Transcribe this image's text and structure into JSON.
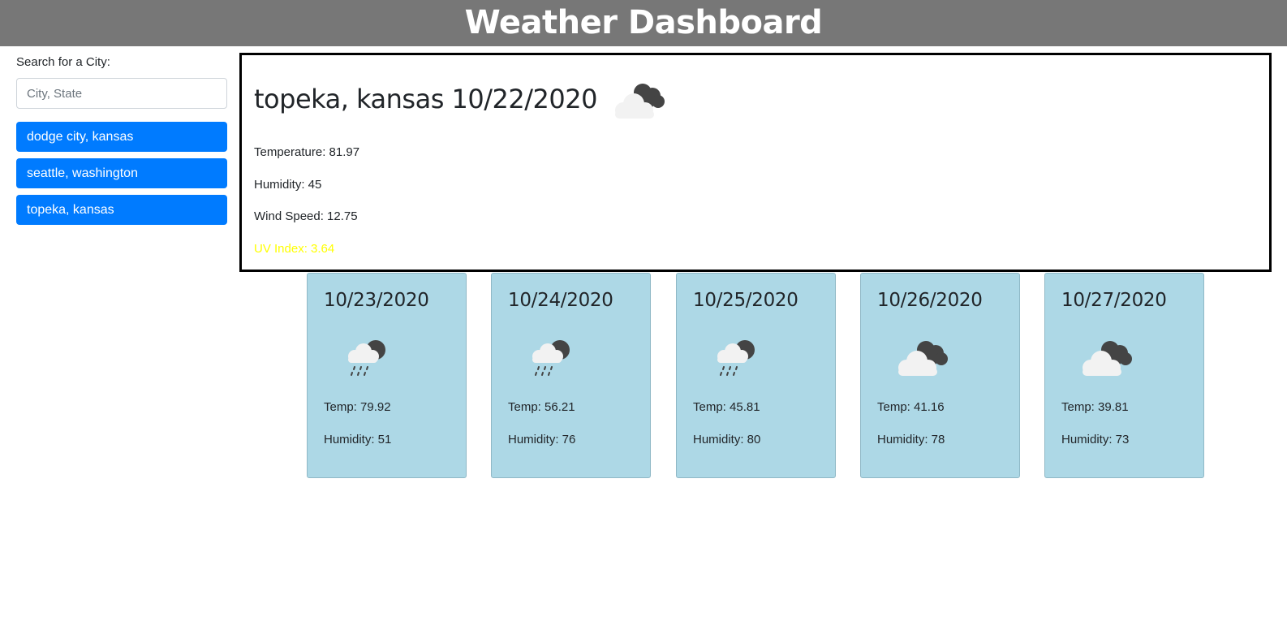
{
  "header": {
    "title": "Weather Dashboard"
  },
  "colors": {
    "header_bg": "#777777",
    "city_button": "#007bff",
    "forecast_card": "#add8e6",
    "uv_index": "#ffff00"
  },
  "search": {
    "label": "Search for a City:",
    "placeholder": "City, State",
    "value": ""
  },
  "history": [
    {
      "label": "dodge city, kansas"
    },
    {
      "label": "seattle, washington"
    },
    {
      "label": "topeka, kansas"
    }
  ],
  "current": {
    "title": "topeka, kansas 10/22/2020",
    "icon": "cloudy-night-icon",
    "temperature": "Temperature: 81.97",
    "humidity": "Humidity: 45",
    "wind": "Wind Speed: 12.75",
    "uv": "UV Index: 3.64"
  },
  "forecast": [
    {
      "date": "10/23/2020",
      "icon": "rain-night-icon",
      "temp": "Temp: 79.92",
      "humidity": "Humidity: 51"
    },
    {
      "date": "10/24/2020",
      "icon": "rain-night-icon",
      "temp": "Temp: 56.21",
      "humidity": "Humidity: 76"
    },
    {
      "date": "10/25/2020",
      "icon": "rain-night-icon",
      "temp": "Temp: 45.81",
      "humidity": "Humidity: 80"
    },
    {
      "date": "10/26/2020",
      "icon": "cloudy-night-icon",
      "temp": "Temp: 41.16",
      "humidity": "Humidity: 78"
    },
    {
      "date": "10/27/2020",
      "icon": "cloudy-night-icon",
      "temp": "Temp: 39.81",
      "humidity": "Humidity: 73"
    }
  ]
}
